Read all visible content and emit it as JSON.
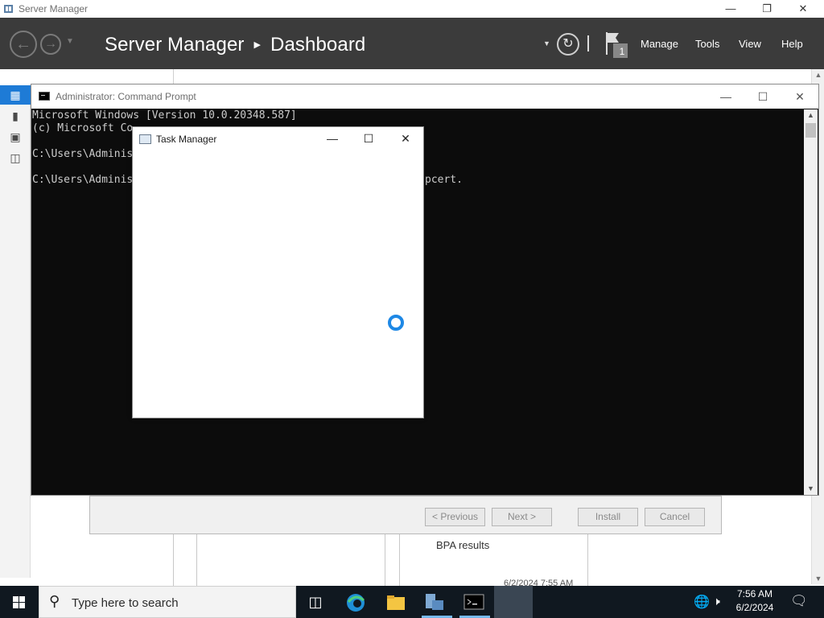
{
  "server_manager": {
    "window_title": "Server Manager",
    "breadcrumb": {
      "app": "Server Manager",
      "page": "Dashboard"
    },
    "flag_count": "1",
    "menu": [
      "Manage",
      "Tools",
      "View",
      "Help"
    ]
  },
  "wizard": {
    "buttons": {
      "previous": "< Previous",
      "next": "Next >",
      "install": "Install",
      "cancel": "Cancel"
    },
    "bpa_label": "BPA results",
    "bpa_date": "6/2/2024 7:55 AM"
  },
  "cmd": {
    "title": "Administrator: Command Prompt",
    "lines": [
      "Microsoft Windows [Version 10.0.20348.587]",
      "(c) Microsoft Co",
      "",
      "C:\\Users\\Adminis",
      "",
      "C:\\Users\\Adminis"
    ],
    "line6_tail": "pcert."
  },
  "task_manager": {
    "title": "Task Manager"
  },
  "taskbar": {
    "search_placeholder": "Type here to search",
    "time": "7:56 AM",
    "date": "6/2/2024"
  },
  "colors": {
    "accent": "#1e7bd6",
    "header": "#3b3b3b",
    "taskbar": "#101820",
    "spinner": "#1e88e5"
  }
}
